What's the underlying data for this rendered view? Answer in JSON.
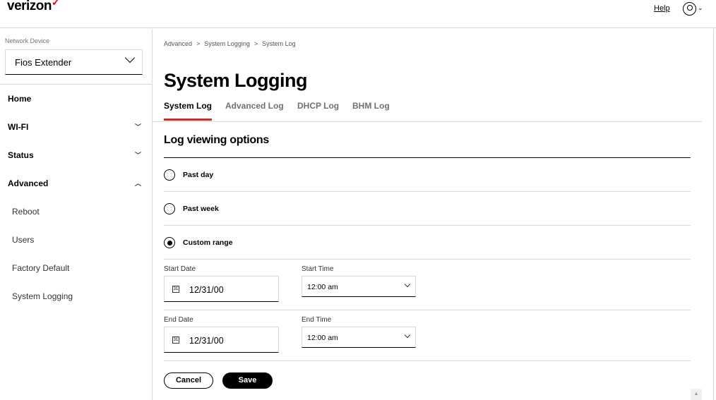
{
  "header": {
    "logo": "verizon",
    "help": "Help"
  },
  "sidebar": {
    "network_device_label": "Network Device",
    "network_device_value": "Fios Extender",
    "items": [
      {
        "label": "Home"
      },
      {
        "label": "Wi-Fi"
      },
      {
        "label": "Status"
      },
      {
        "label": "Advanced"
      }
    ],
    "sub_items": [
      {
        "label": "Reboot"
      },
      {
        "label": "Users"
      },
      {
        "label": "Factory Default"
      },
      {
        "label": "System Logging"
      }
    ]
  },
  "breadcrumb": [
    "Advanced",
    ">",
    "System Logging",
    ">",
    "System Log"
  ],
  "page_title": "System Logging",
  "tabs": [
    {
      "label": "System Log"
    },
    {
      "label": "Advanced Log"
    },
    {
      "label": "DHCP Log"
    },
    {
      "label": "BHM Log"
    }
  ],
  "section_title": "Log viewing options",
  "options": [
    {
      "label": "Past day",
      "selected": false
    },
    {
      "label": "Past week",
      "selected": false
    },
    {
      "label": "Custom range",
      "selected": true
    }
  ],
  "start_date": {
    "label": "Start Date",
    "value": "12/31/00"
  },
  "start_time": {
    "label": "Start Time",
    "value": "12:00 am"
  },
  "end_date": {
    "label": "End Date",
    "value": "12/31/00"
  },
  "end_time": {
    "label": "End Time",
    "value": "12:00 am"
  },
  "buttons": {
    "cancel": "Cancel",
    "save": "Save"
  },
  "calendar_icon_text": "31",
  "colors": {
    "accent": "#d52b1e"
  }
}
